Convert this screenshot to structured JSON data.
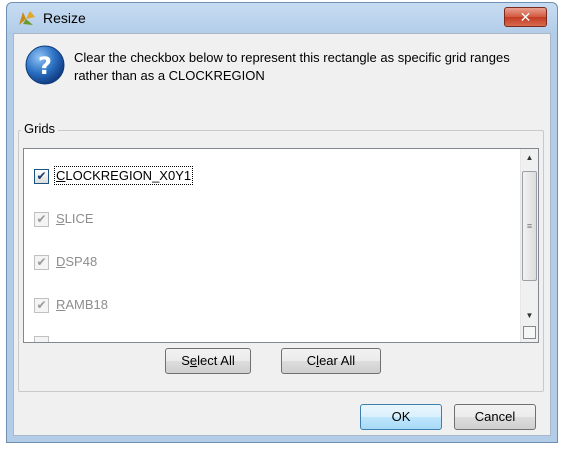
{
  "window": {
    "title": "Resize",
    "close_label": "✕"
  },
  "message": {
    "text": "Clear the checkbox below to represent this rectangle as specific grid ranges rather than as a CLOCKREGION"
  },
  "grids": {
    "group_label": "Grids",
    "items": [
      {
        "label": "CLOCKREGION_X0Y1",
        "mnemonic": "C",
        "rest": "LOCKREGION_X0Y1",
        "checked": true,
        "enabled": true
      },
      {
        "label": "SLICE",
        "mnemonic": "S",
        "rest": "LICE",
        "checked": true,
        "enabled": false
      },
      {
        "label": "DSP48",
        "mnemonic": "D",
        "rest": "SP48",
        "checked": true,
        "enabled": false
      },
      {
        "label": "RAMB18",
        "mnemonic": "R",
        "rest": "AMB18",
        "checked": true,
        "enabled": false
      }
    ]
  },
  "buttons": {
    "select_all": {
      "pre": "S",
      "mn": "e",
      "post": "lect All"
    },
    "clear_all": {
      "pre": "C",
      "mn": "l",
      "post": "ear All"
    },
    "ok": "OK",
    "cancel": "Cancel"
  },
  "colors": {
    "title_bar": "#b3cde9",
    "close_button": "#c23a22",
    "default_button_border": "#3c7fb1"
  }
}
